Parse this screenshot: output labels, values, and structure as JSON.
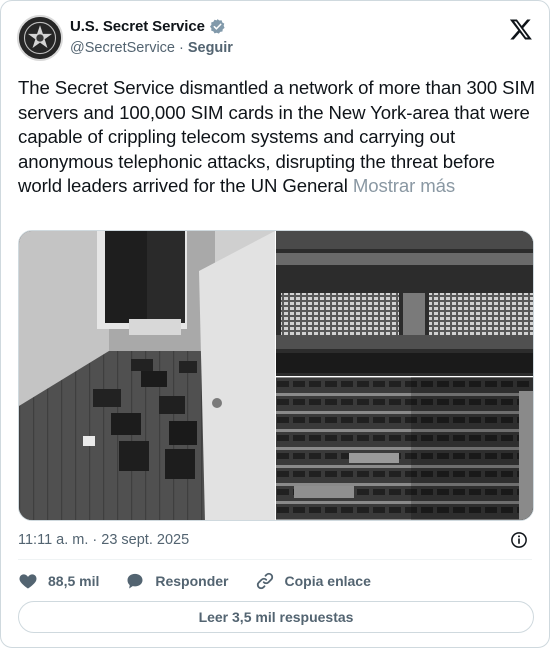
{
  "account": {
    "display_name": "U.S. Secret Service",
    "handle": "@SecretService",
    "separator": "·",
    "follow_label": "Seguir"
  },
  "tweet": {
    "text": "The Secret Service dismantled a network of more than 300 SIM servers and 100,000 SIM cards in the New York-area that were capable of crippling telecom systems and carrying out anonymous telephonic attacks, disrupting the threat before world leaders arrived for the UN General",
    "show_more_label": "Mostrar más",
    "timestamp": "11:11 a. m. · 23 sept. 2025"
  },
  "media": {
    "count": 3
  },
  "actions": {
    "like_count": "88,5 mil",
    "reply_label": "Responder",
    "copy_link_label": "Copia enlace",
    "read_replies_label": "Leer 3,5 mil respuestas"
  },
  "icons": {
    "avatar": "secret-service-star-seal-icon",
    "verified": "verified-badge-icon",
    "brand": "x-logo-icon",
    "info": "info-icon",
    "like": "heart-icon",
    "reply": "speech-bubble-icon",
    "copy_link": "link-icon"
  },
  "colors": {
    "text": "#0f1419",
    "secondary": "#536471",
    "border": "#cfd9de",
    "verified_badge": "#829aab"
  }
}
